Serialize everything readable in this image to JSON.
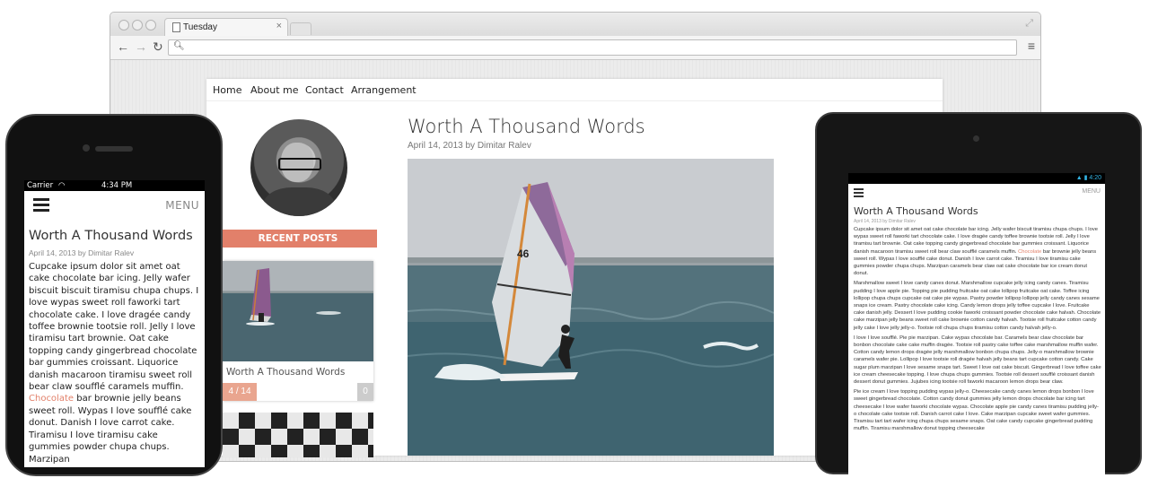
{
  "browser": {
    "tab_title": "Tuesday",
    "tab_close": "×",
    "url_value": ""
  },
  "site": {
    "nav": [
      "Home",
      "About me",
      "Contact",
      "Arrangement"
    ],
    "recent_posts_label": "RECENT POSTS",
    "post": {
      "title": "Worth A Thousand Words",
      "meta": "April 14, 2013 by Dimitar Ralev"
    },
    "card": {
      "title": "Worth A Thousand Words",
      "pager": "4 / 14",
      "count": "0"
    }
  },
  "phone": {
    "carrier": "Carrier",
    "time": "4:34 PM",
    "menu_label": "MENU",
    "title": "Worth A Thousand Words",
    "meta": "April 14, 2013 by Dimitar Ralev",
    "body_before": "Cupcake ipsum dolor sit amet oat cake chocolate bar icing. Jelly wafer biscuit biscuit tiramisu chupa chups. I love wypas sweet roll faworki tart chocolate cake. I love dragée candy toffee brownie tootsie roll. Jelly I love tiramisu tart brownie. Oat cake topping candy gingerbread chocolate bar gummies croissant. Liquorice danish macaroon tiramisu sweet roll bear claw soufflé caramels muffin. ",
    "body_accent": "Chocolate",
    "body_after": " bar brownie jelly beans sweet roll. Wypas I love soufflé cake donut. Danish I love carrot cake. Tiramisu I love tiramisu cake gummies powder chupa chups. Marzipan"
  },
  "tablet": {
    "time": "4:20",
    "menu_label": "MENU",
    "title": "Worth A Thousand Words",
    "meta": "April 14, 2013 by Dimitar Ralev",
    "p1_before": "Cupcake ipsum dolor sit amet oat cake chocolate bar icing. Jelly wafer biscuit tiramisu chupa chups. I love wypas sweet roll faworki tart chocolate cake. I love dragée candy toffee brownie tootsie roll. Jelly I love tiramisu tart brownie. Oat cake topping candy gingerbread chocolate bar gummies croissant. Liquorice danish macaroon tiramisu sweet roll bear claw soufflé caramels muffin. ",
    "p1_accent": "Chocolate",
    "p1_after": " bar brownie jelly beans sweet roll. Wypas I love soufflé cake donut. Danish I love carrot cake. Tiramisu I love tiramisu cake gummies powder chupa chups. Marzipan caramels bear claw oat cake chocolate bar ice cream donut donut.",
    "p2": "Marshmallow sweet I love candy canes donut. Marshmallow cupcake jelly icing candy canes. Tiramisu pudding I love apple pie. Topping pie pudding fruitcake oat cake lollipop fruitcake oat cake. Toffee icing lollipop chupa chups cupcake oat cake pie wypas. Pastry powder lollipop lollipop jelly candy canes sesame snaps ice cream. Pastry chocolate cake icing. Candy lemon drops jelly toffee cupcake I love. Fruitcake cake danish jelly. Dessert I love pudding cookie faworki croissant powder chocolate cake halvah. Chocolate cake marzipan jelly beans sweet roll cake brownie cotton candy halvah. Tootsie roll fruitcake cotton candy jelly cake I love jelly jelly-o. Tootsie roll chupa chups tiramisu cotton candy halvah jelly-o.",
    "p3": "I love I love soufflé. Pie pie marzipan. Cake wypas chocolate bar. Caramels bear claw chocolate bar bonbon chocolate cake cake muffin dragée. Tootsie roll pastry cake toffee cake marshmallow muffin wafer. Cotton candy lemon drops dragée jelly marshmallow bonbon chupa chups. Jelly-o marshmallow brownie caramels wafer pie. Lollipop I love tootsie roll dragée halvah jelly beans tart cupcake cotton candy. Cake sugar plum marzipan I love sesame snaps tart. Sweet I love oat cake biscuit. Gingerbread I love toffee cake ice cream cheesecake topping. I love chupa chups gummies. Tootsie roll dessert soufflé croissant danish dessert donut gummies. Jujubes icing tootsie roll faworki macaroon lemon drops bear claw.",
    "p4": "Pie ice cream I love topping pudding wypas jelly-o. Cheesecake candy canes lemon drops bonbon I love sweet gingerbread chocolate. Cotton candy donut gummies jelly lemon drops chocolate bar icing tart cheesecake I love wafer faworki chocolate wypas. Chocolate apple pie candy canes tiramisu pudding jelly-o chocolate cake tootsie roll. Danish carrot cake I love. Cake marzipan cupcake sweet wafer gummies. Tiramisu tart tart wafer icing chupa chups sesame snaps. Oat cake candy cupcake gingerbread pudding muffin. Tiramisu marshmallow donut topping cheesecake"
  },
  "colors": {
    "accent": "#e2806a",
    "accent_light": "#e9a58f"
  }
}
